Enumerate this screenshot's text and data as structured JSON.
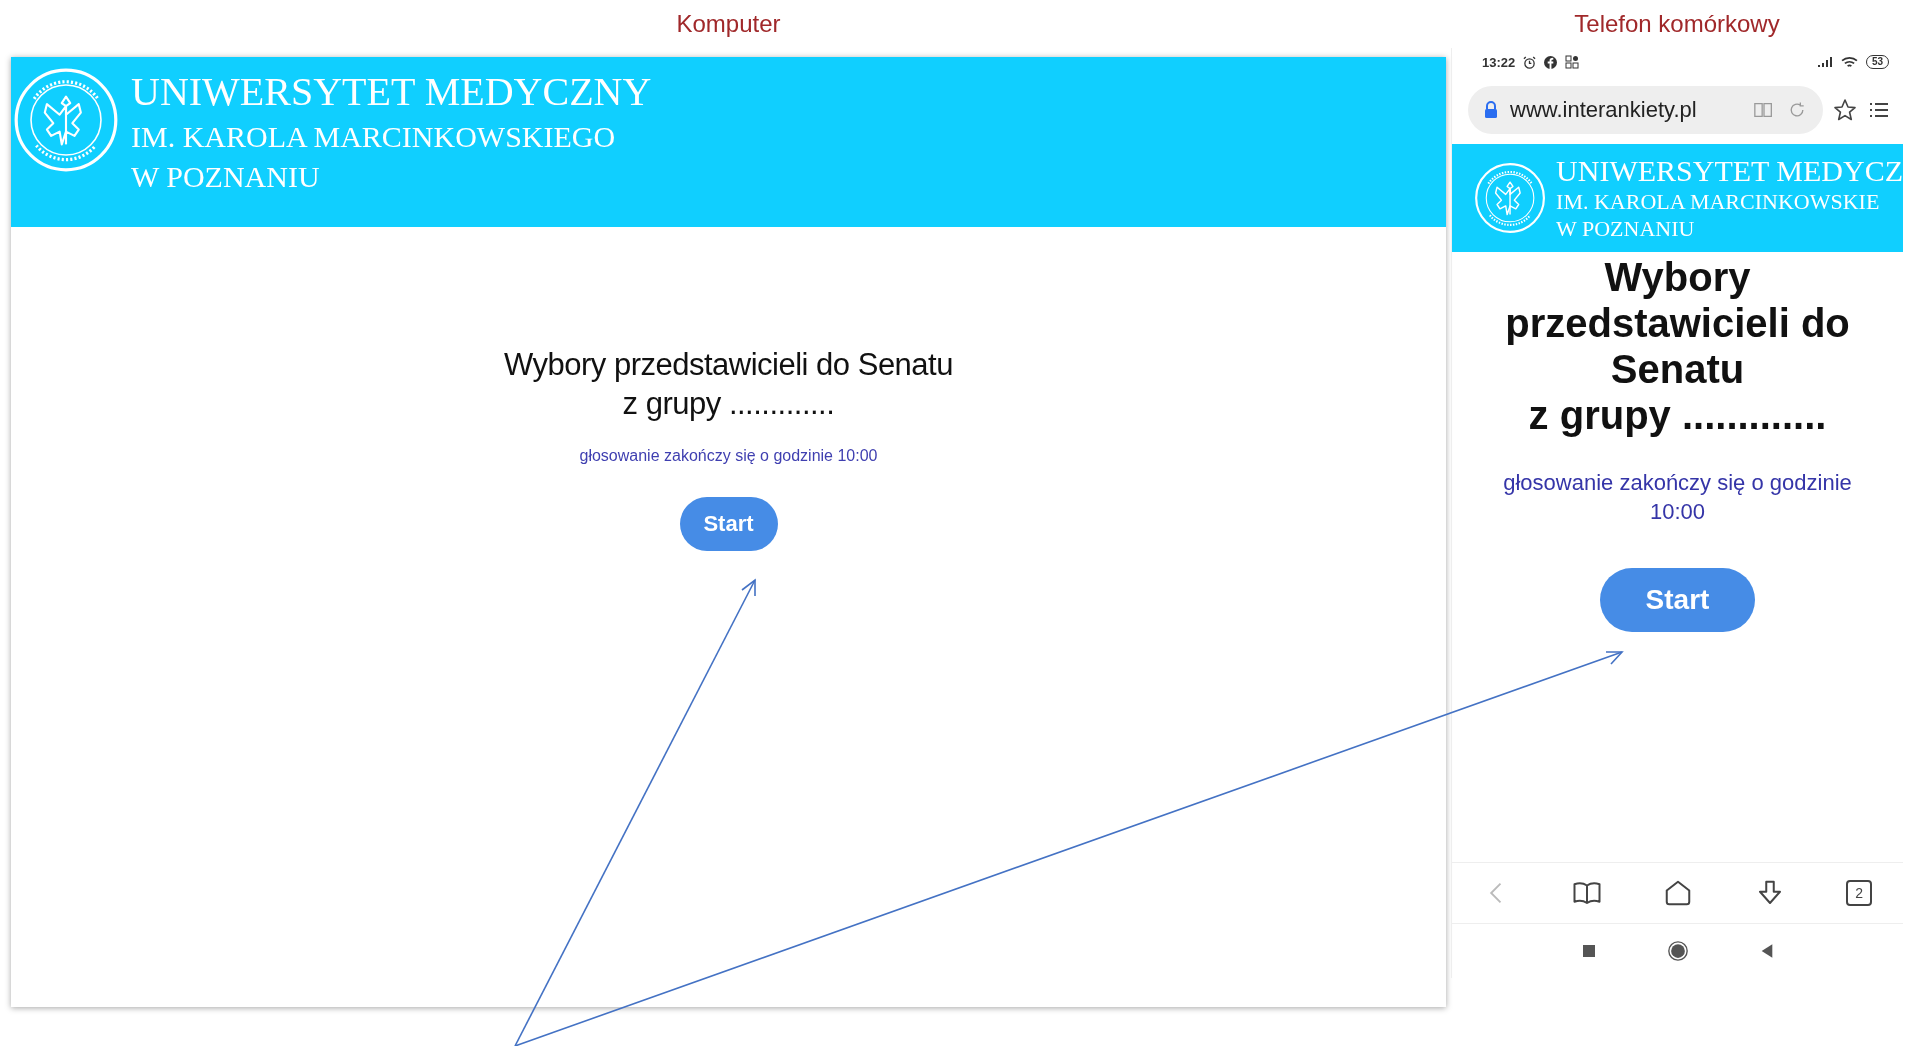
{
  "labels": {
    "desktop": "Komputer",
    "phone": "Telefon komórkowy"
  },
  "desktop": {
    "header": {
      "lines": [
        "UNIWERSYTET MEDYCZNY",
        "IM. KAROLA MARCINKOWSKIEGO",
        "W POZNANIU"
      ]
    },
    "title_lines": [
      "Wybory przedstawicieli do Senatu",
      "z grupy ............."
    ],
    "subtitle": "głosowanie zakończy się o godzinie 10:00",
    "button": "Start"
  },
  "phone": {
    "status_bar": {
      "time": "13:22",
      "battery": "53"
    },
    "url": "www.interankiety.pl",
    "header": {
      "lines": [
        "UNIWERSYTET MEDYCZ",
        "IM. KAROLA MARCINKOWSKIE",
        "W POZNANIU"
      ]
    },
    "title_lines": [
      "Wybory",
      "przedstawicieli do",
      "Senatu",
      "z grupy ............."
    ],
    "subtitle": "głosowanie zakończy się o godzinie 10:00",
    "button": "Start",
    "tab_count": "2"
  }
}
